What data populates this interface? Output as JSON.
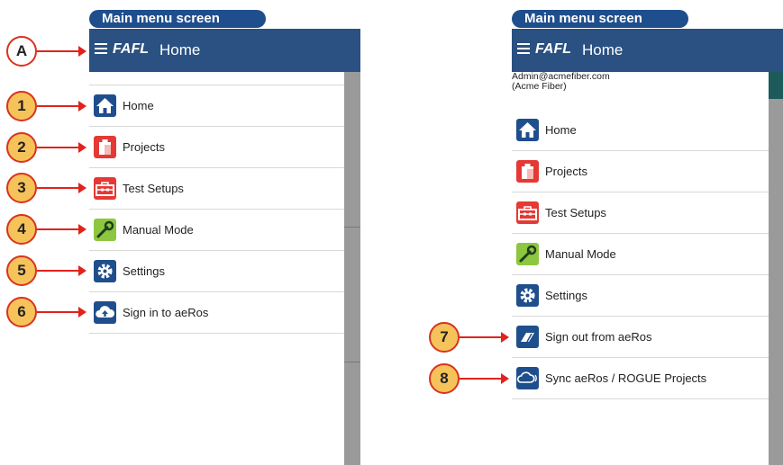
{
  "left_panel": {
    "tab_label": "Main menu screen",
    "appbar": {
      "logo": "FAFL",
      "title": "Home"
    },
    "items": [
      {
        "label": "Home",
        "icon": "home-icon",
        "color": "#1f4e8c"
      },
      {
        "label": "Projects",
        "icon": "clipboard-icon",
        "color": "#e53935"
      },
      {
        "label": "Test Setups",
        "icon": "toolbox-icon",
        "color": "#e53935"
      },
      {
        "label": "Manual Mode",
        "icon": "wrench-icon",
        "color": "#8dc63f"
      },
      {
        "label": "Settings",
        "icon": "gear-icon",
        "color": "#1f4e8c"
      },
      {
        "label": "Sign in to aeRos",
        "icon": "cloud-upload-icon",
        "color": "#1f4e8c"
      }
    ]
  },
  "right_panel": {
    "tab_label": "Main menu screen",
    "appbar": {
      "logo": "FAFL",
      "title": "Home"
    },
    "account": {
      "email": "Admin@acmefiber.com",
      "org": "(Acme Fiber)"
    },
    "items": [
      {
        "label": "Home",
        "icon": "home-icon",
        "color": "#1f4e8c"
      },
      {
        "label": "Projects",
        "icon": "clipboard-icon",
        "color": "#e53935"
      },
      {
        "label": "Test Setups",
        "icon": "toolbox-icon",
        "color": "#e53935"
      },
      {
        "label": "Manual Mode",
        "icon": "wrench-icon",
        "color": "#8dc63f"
      },
      {
        "label": "Settings",
        "icon": "gear-icon",
        "color": "#1f4e8c"
      },
      {
        "label": "Sign out from aeRos",
        "icon": "eraser-icon",
        "color": "#1f4e8c"
      },
      {
        "label": "Sync aeRos / ROGUE Projects",
        "icon": "cloud-sync-icon",
        "color": "#1f4e8c"
      }
    ]
  },
  "callouts": {
    "a": "A",
    "n1": "1",
    "n2": "2",
    "n3": "3",
    "n4": "4",
    "n5": "5",
    "n6": "6",
    "n7": "7",
    "n8": "8"
  }
}
